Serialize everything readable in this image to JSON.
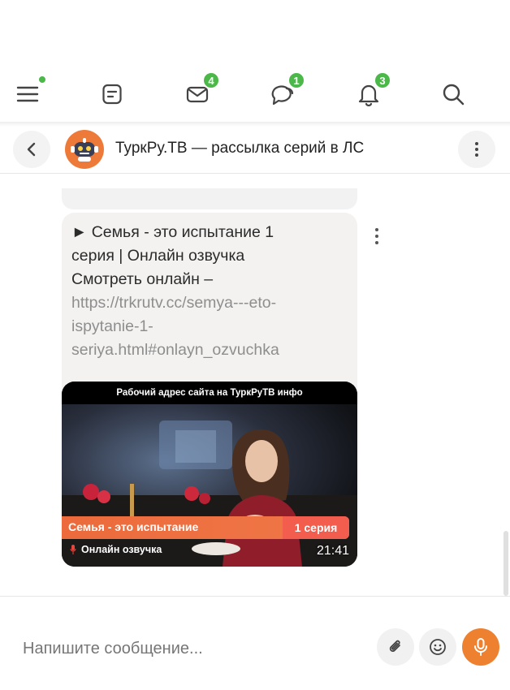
{
  "nav": {
    "items": [
      {
        "name": "menu",
        "icon": "hamburger-icon"
      },
      {
        "name": "notes",
        "icon": "note-icon"
      },
      {
        "name": "mail",
        "icon": "envelope-icon",
        "badge": "4"
      },
      {
        "name": "chats",
        "icon": "chat-bubbles-icon",
        "badge": "1"
      },
      {
        "name": "notifications",
        "icon": "bell-icon",
        "badge": "3"
      },
      {
        "name": "search",
        "icon": "search-icon"
      }
    ],
    "badge_color": "#4cb849"
  },
  "chat_header": {
    "title": "ТуркРу.ТВ — рассылка серий в ЛС",
    "avatar_color": "#ee7a3a"
  },
  "message": {
    "lines": [
      "► Семья - это испытание 1",
      "серия | Онлайн озвучка",
      "Смотреть онлайн –"
    ],
    "link_lines": [
      "https://trkrutv.cc/semya---eto-",
      "ispytanie-1-",
      "seriya.html#onlayn_ozvuchka"
    ],
    "video": {
      "top_caption": "Рабочий адрес сайта на ТуркРуТВ инфо",
      "show_title": "Семья - это испытание",
      "episode": "1 серия",
      "dub_label": "Онлайн озвучка",
      "duration": "21:41",
      "accent_color": "#ec6a3c"
    }
  },
  "composer": {
    "placeholder": "Напишите сообщение...",
    "mic_color": "#ee8130"
  }
}
